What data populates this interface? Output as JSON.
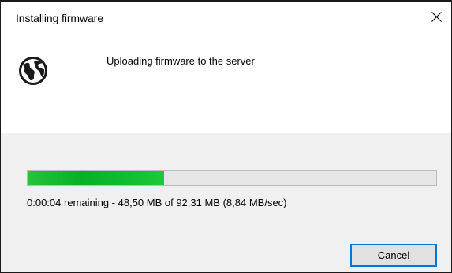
{
  "window": {
    "title": "Installing firmware"
  },
  "icons": {
    "main": "globe-icon",
    "close": "close-icon"
  },
  "dialog": {
    "message": "Uploading firmware to the server",
    "progress_fraction": 0.334,
    "status": "0:00:04 remaining - 48,50 MB of 92,31 MB (8,84 MB/sec)"
  },
  "buttons": {
    "cancel_mnemonic": "C",
    "cancel_rest": "ancel"
  },
  "colors": {
    "progress_fill": "#06b025",
    "button_focus_border": "#0078d7",
    "footer_background": "#f0f0f0"
  }
}
